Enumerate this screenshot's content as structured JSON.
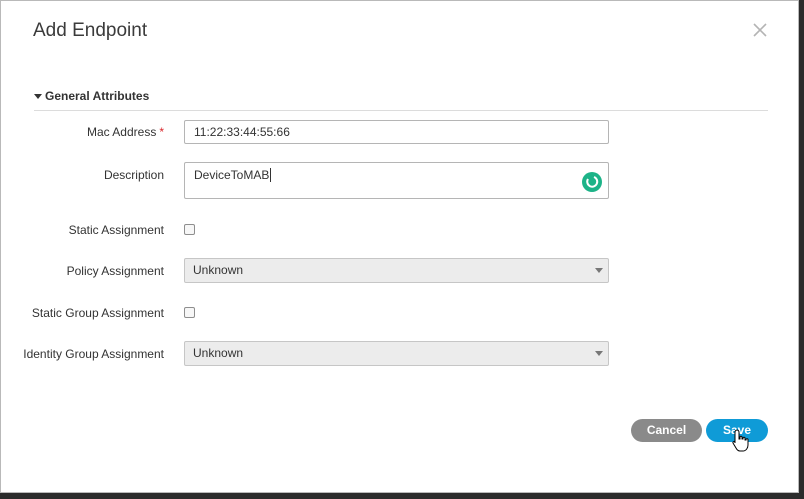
{
  "dialog": {
    "title": "Add Endpoint",
    "close_icon": "close-icon"
  },
  "section": {
    "title": "General Attributes",
    "caret_icon": "caret-down-icon"
  },
  "fields": {
    "mac_address": {
      "label": "Mac Address",
      "required_marker": "*",
      "value": "11:22:33:44:55:66"
    },
    "description": {
      "label": "Description",
      "value": "DeviceToMAB"
    },
    "static_assignment": {
      "label": "Static Assignment",
      "checked": false
    },
    "policy_assignment": {
      "label": "Policy Assignment",
      "selected": "Unknown"
    },
    "static_group_assignment": {
      "label": "Static Group Assignment",
      "checked": false
    },
    "identity_group_assignment": {
      "label": "Identity Group Assignment",
      "selected": "Unknown"
    }
  },
  "buttons": {
    "cancel": "Cancel",
    "save": "Save"
  },
  "colors": {
    "save_button": "#0f9bd7",
    "cancel_button": "#8a8a8a",
    "required_marker": "#d9262b",
    "spinner": "#1db388"
  }
}
